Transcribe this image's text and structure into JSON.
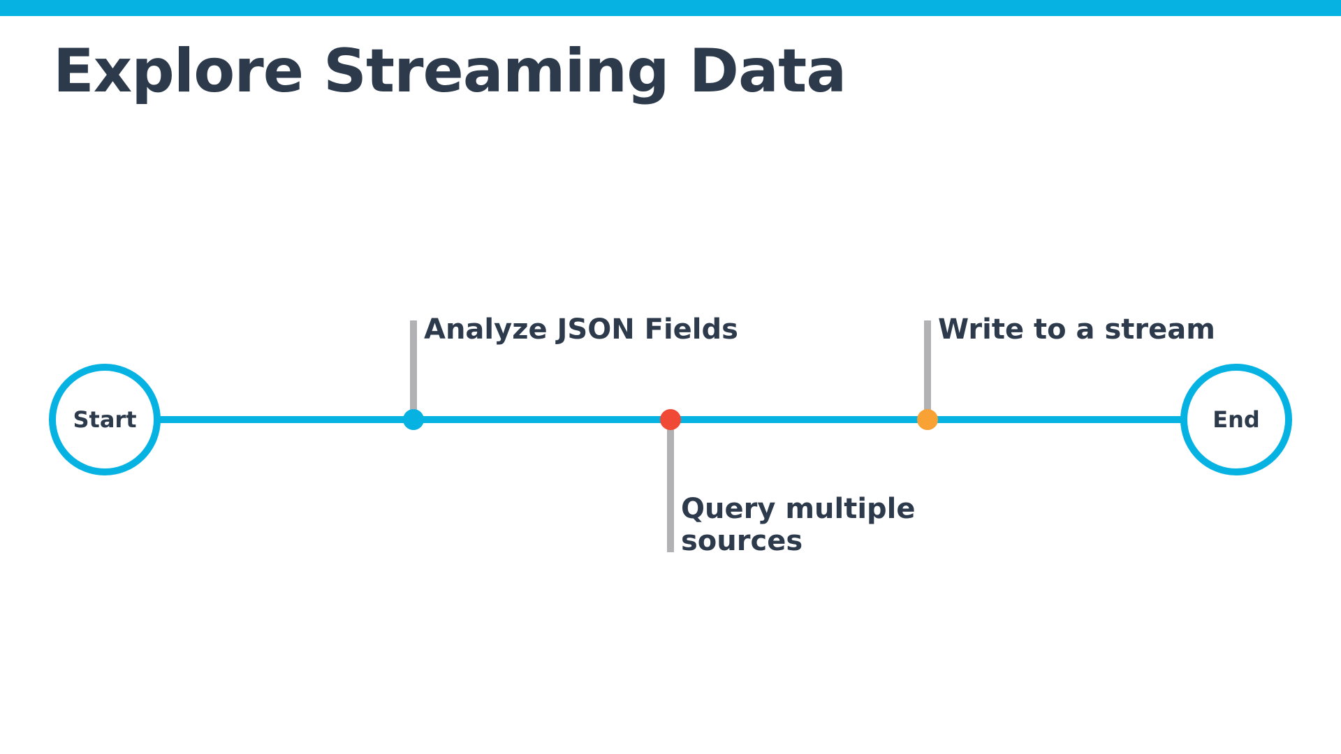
{
  "slide": {
    "title": "Explore Streaming Data"
  },
  "colors": {
    "accent": "#05b2e2",
    "text": "#2c3a4b",
    "connector": "#b2b2b6",
    "milestone_blue": "#05b2e2",
    "milestone_red": "#f04a36",
    "milestone_orange": "#f8a134"
  },
  "timeline": {
    "start_label": "Start",
    "end_label": "End",
    "milestones": [
      {
        "label": "Analyze JSON Fields",
        "color": "#05b2e2",
        "side": "above"
      },
      {
        "label_line1": "Query multiple",
        "label_line2": "sources",
        "color": "#f04a36",
        "side": "below"
      },
      {
        "label": "Write to a stream",
        "color": "#f8a134",
        "side": "above"
      }
    ]
  }
}
